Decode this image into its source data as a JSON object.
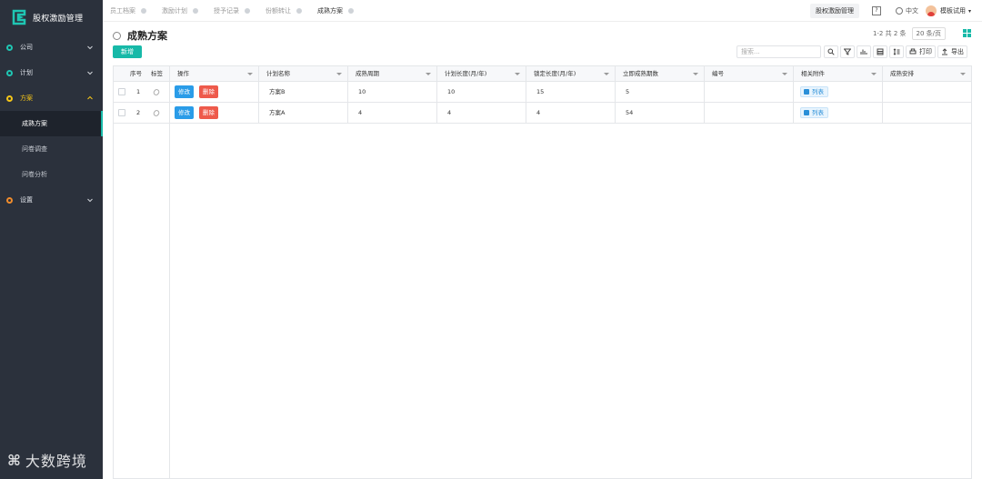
{
  "sidebar": {
    "brand": "股权激励管理",
    "menu": [
      {
        "label": "公司",
        "expanded": false
      },
      {
        "label": "计划",
        "expanded": false
      },
      {
        "label": "方案",
        "expanded": true,
        "children": [
          "成熟方案",
          "问卷调查",
          "问卷分析"
        ]
      },
      {
        "label": "设置",
        "expanded": false
      }
    ],
    "watermark": "大数跨境"
  },
  "topbar": {
    "tabs": [
      "员工档案",
      "激励计划",
      "授予记录",
      "份额转让",
      "成熟方案"
    ],
    "active_tab": "成熟方案",
    "module_button": "股权激励管理",
    "help": "?",
    "language": "中文",
    "user": "模板试用"
  },
  "page": {
    "title": "成熟方案",
    "new_button": "新增",
    "pager_text": "1-2 共 2 条",
    "page_size": "20 条/页",
    "search_placeholder": "搜索...",
    "print_label": "打印",
    "export_label": "导出"
  },
  "table": {
    "columns": [
      "序号",
      "标签",
      "操作",
      "计划名称",
      "成熟周期",
      "计划长度(月/年)",
      "锁定长度(月/年)",
      "立即成熟期数",
      "编号",
      "相关附件",
      "成熟安排"
    ],
    "edit_label": "修改",
    "delete_label": "删除",
    "attachment_label": "列表",
    "rows": [
      {
        "seq": "1",
        "plan": "方案B",
        "cycle": "10",
        "plan_len": "10",
        "lock_len": "15",
        "immediate": "5",
        "code": "",
        "schedule": ""
      },
      {
        "seq": "2",
        "plan": "方案A",
        "cycle": "4",
        "plan_len": "4",
        "lock_len": "4",
        "immediate": "54",
        "code": "",
        "schedule": ""
      }
    ]
  },
  "colors": {
    "sidebar_bg": "#2b313c",
    "accent": "#17b9a8",
    "edit": "#2a9ce8",
    "delete": "#ee5a4b",
    "active_menu": "#f5c518"
  }
}
